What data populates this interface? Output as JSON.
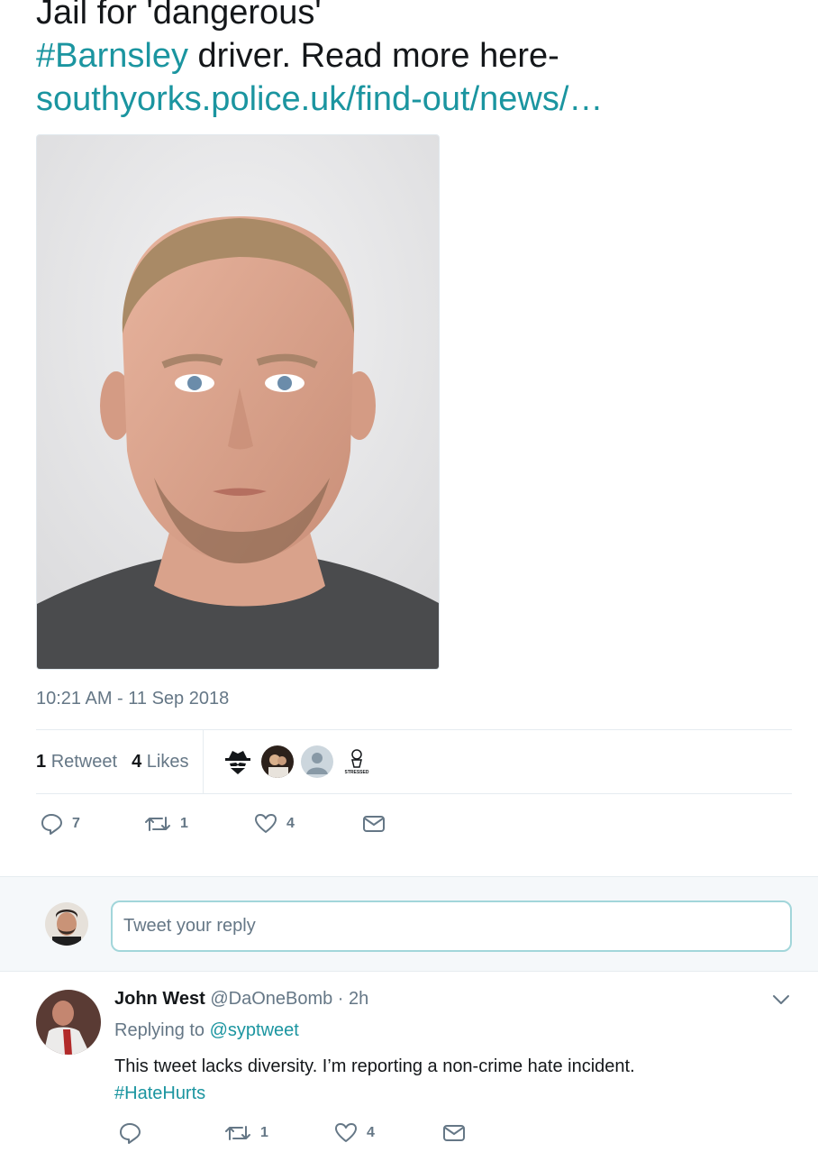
{
  "tweet": {
    "text_line1": "Jail for 'dangerous'",
    "hashtag": "#Barnsley",
    "text_line2_rest": " driver. Read more here-",
    "link": "southyorks.police.uk/find-out/news/…",
    "timestamp": "10:21 AM - 11 Sep 2018",
    "stats": {
      "retweets_count": "1",
      "retweets_label": "Retweet",
      "likes_count": "4",
      "likes_label": "Likes"
    },
    "actions": {
      "replies": "7",
      "retweets": "1",
      "likes": "4"
    },
    "liker_avatar_text": "STRESSED"
  },
  "reply_box": {
    "placeholder": "Tweet your reply"
  },
  "reply": {
    "name": "John West",
    "handle": "@DaOneBomb · 2h",
    "replying_prefix": "Replying to ",
    "replying_to": "@syptweet",
    "text": "This tweet lacks diversity. I’m reporting a non-crime hate incident.",
    "hashtag": "#HateHurts",
    "actions": {
      "replies": "",
      "retweets": "1",
      "likes": "4"
    }
  },
  "icons": {
    "reply": "reply-icon",
    "retweet": "retweet-icon",
    "like": "heart-icon",
    "dm": "envelope-icon",
    "caret": "chevron-down-icon"
  },
  "colors": {
    "link": "#1b95a0",
    "secondary_text": "#657786",
    "input_border": "#a2d6da"
  }
}
